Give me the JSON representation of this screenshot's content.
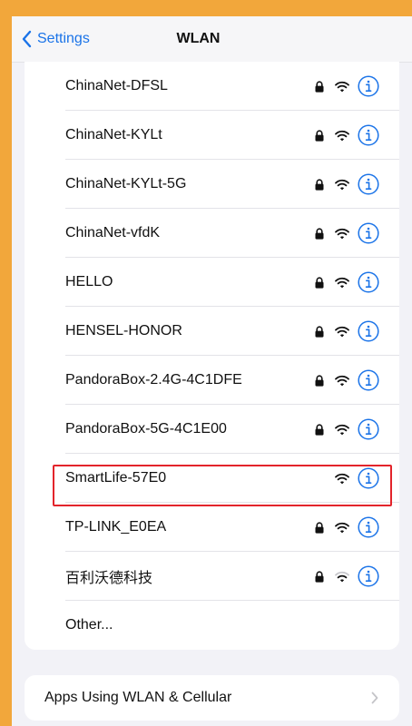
{
  "nav": {
    "back_label": "Settings",
    "title": "WLAN",
    "accent_color": "#1a73e8"
  },
  "networks": [
    {
      "name": "ChinaNet-DFSL",
      "locked": true,
      "signal": "full"
    },
    {
      "name": "ChinaNet-KYLt",
      "locked": true,
      "signal": "full"
    },
    {
      "name": "ChinaNet-KYLt-5G",
      "locked": true,
      "signal": "full"
    },
    {
      "name": "ChinaNet-vfdK",
      "locked": true,
      "signal": "full"
    },
    {
      "name": "HELLO",
      "locked": true,
      "signal": "full"
    },
    {
      "name": "HENSEL-HONOR",
      "locked": true,
      "signal": "full"
    },
    {
      "name": "PandoraBox-2.4G-4C1DFE",
      "locked": true,
      "signal": "full"
    },
    {
      "name": "PandoraBox-5G-4C1E00",
      "locked": true,
      "signal": "full"
    },
    {
      "name": "SmartLife-57E0",
      "locked": false,
      "signal": "full",
      "highlighted": true
    },
    {
      "name": "TP-LINK_E0EA",
      "locked": true,
      "signal": "full"
    },
    {
      "name": "百利沃德科技",
      "locked": true,
      "signal": "weak"
    }
  ],
  "other_label": "Other...",
  "apps_section": {
    "label": "Apps Using WLAN & Cellular"
  },
  "colors": {
    "highlight": "#e3242b",
    "frame": "#f2a73b"
  },
  "icons": {
    "lock": "lock-icon",
    "wifi": "wifi-icon",
    "info": "info-icon",
    "back": "chevron-left-icon",
    "forward": "chevron-right-icon"
  }
}
